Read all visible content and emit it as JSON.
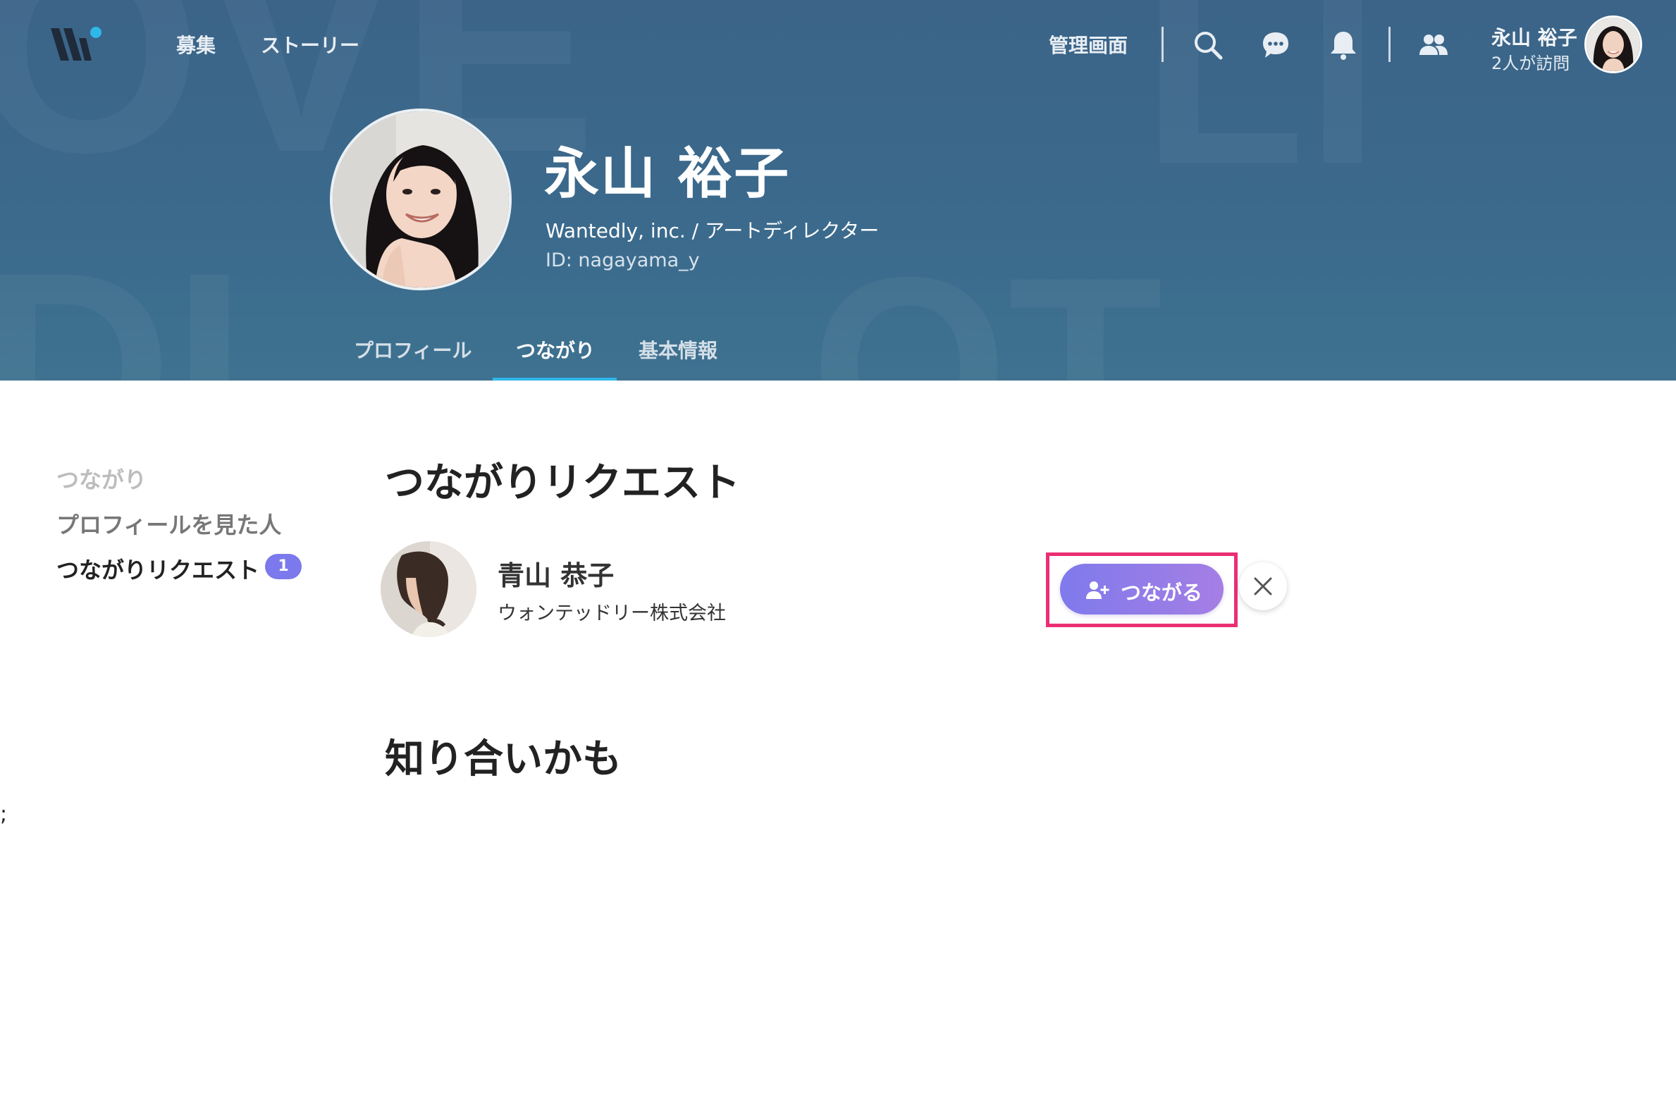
{
  "header": {
    "nav": [
      "募集",
      "ストーリー"
    ],
    "admin_label": "管理画面",
    "user_name": "永山 裕子",
    "visits_text": "2人が訪問",
    "icons": [
      "search-icon",
      "chat-icon",
      "bell-icon",
      "people-icon"
    ]
  },
  "profile": {
    "name": "永山 裕子",
    "role": "Wantedly, inc. / アートディレクター",
    "id_text": "ID: nagayama_y"
  },
  "tabs": [
    {
      "label": "プロフィール",
      "active": false
    },
    {
      "label": "つながり",
      "active": true
    },
    {
      "label": "基本情報",
      "active": false
    }
  ],
  "side_nav": [
    {
      "label": "つながり",
      "state": "muted"
    },
    {
      "label": "プロフィールを見た人",
      "state": "normal"
    },
    {
      "label": "つながりリクエスト",
      "state": "active",
      "badge": "1"
    }
  ],
  "requests_section": {
    "title": "つながりリクエスト",
    "items": [
      {
        "name": "青山 恭子",
        "company": "ウォンテッドリー株式会社",
        "connect_label": "つながる"
      }
    ]
  },
  "suggest_section": {
    "title": "知り合いかも"
  },
  "stray_text": ";",
  "colors": {
    "accent_tab": "#2fb7e9",
    "button_gradient_start": "#7f7aec",
    "button_gradient_end": "#a57ee4",
    "highlight": "#ea2f74",
    "badge": "#7b79ec"
  }
}
